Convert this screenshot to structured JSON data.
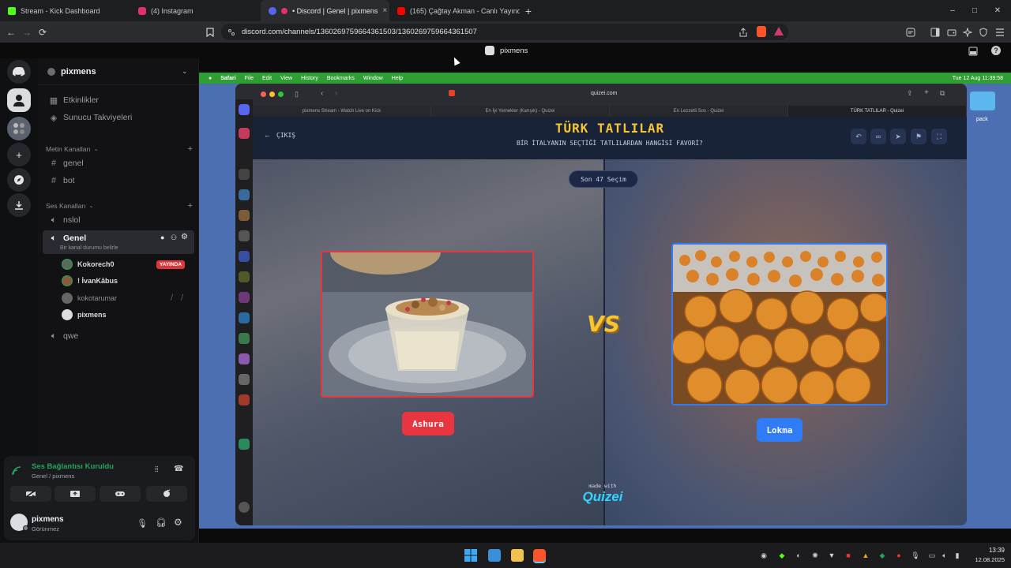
{
  "browser": {
    "tabs": [
      {
        "label": "Stream - Kick Dashboard",
        "color": "#53fc18"
      },
      {
        "label": "(4) Instagram",
        "color": "#e1306c"
      },
      {
        "label": "• Discord | Genel | pixmens",
        "color": "#5865f2",
        "active": true
      },
      {
        "label": "(165) Çağtay Akman - Canlı Yayında",
        "color": "#ff0000"
      }
    ],
    "url": "discord.com/channels/1360269759664361503/1360269759664361507",
    "icons": {
      "back": "←",
      "forward": "→",
      "reload": "⟳",
      "new_tab": "+",
      "close": "×",
      "minimize": "–",
      "maximize": "□",
      "window_close": "✕"
    }
  },
  "discord": {
    "server_name": "pixmens",
    "top_items": [
      {
        "label": "Etkinlikler",
        "icon": "calendar-icon"
      },
      {
        "label": "Sunucu Takviyeleri",
        "icon": "boost-icon"
      }
    ],
    "text_category": "Metin Kanalları",
    "text_channels": [
      "genel",
      "bot"
    ],
    "voice_category": "Ses Kanalları",
    "voice_channels": [
      {
        "name": "nslol"
      },
      {
        "name": "Genel",
        "active": true,
        "status": "Bir kanal durumu belirle"
      },
      {
        "name": "qwe"
      }
    ],
    "voice_users": [
      {
        "name": "Kokorech0",
        "badge": "YAYINDA"
      },
      {
        "name": "! İvanKābus"
      },
      {
        "name": "kokotarumar",
        "muted": true
      },
      {
        "name": "pixmens"
      }
    ],
    "connection": {
      "title": "Ses Bağlantısı Kuruldu",
      "subtitle": "Genel / pixmens"
    },
    "user": {
      "name": "pixmens",
      "status": "Görünmez"
    },
    "stream_title": "pixmens",
    "accent": "#5865f2",
    "live_color": "#da373c",
    "connected_color": "#23a559"
  },
  "mac": {
    "menu": [
      "Safari",
      "File",
      "Edit",
      "View",
      "History",
      "Bookmarks",
      "Window",
      "Help"
    ],
    "clock": "Tue 12 Aug  11:39:58",
    "desktop_folder": "pack",
    "url": "quizei.com",
    "safari_tabs": [
      "pixmens Stream - Watch Live on Kick",
      "En İyi Yemekler (Karışık) - Quizei",
      "En Lezzetli Sos - Quizei",
      "TÜRK TATLILAR - Quizei"
    ]
  },
  "quiz": {
    "exit_label": "ÇIKIŞ",
    "title": "TÜRK TATLILAR",
    "subtitle": "BİR İTALYANIN SEÇTİĞİ TATLILARDAN HANGİSİ FAVORİ?",
    "round_label": "Son 47 Seçim",
    "vs": "VS",
    "left": {
      "label": "Ashura",
      "color": "#e8353f"
    },
    "right": {
      "label": "Lokma",
      "color": "#2f7cf6"
    },
    "made_with": "made with",
    "brand": "Quizei",
    "title_color": "#f7c533"
  },
  "taskbar": {
    "time": "13:39",
    "date": "12.08.2025"
  }
}
